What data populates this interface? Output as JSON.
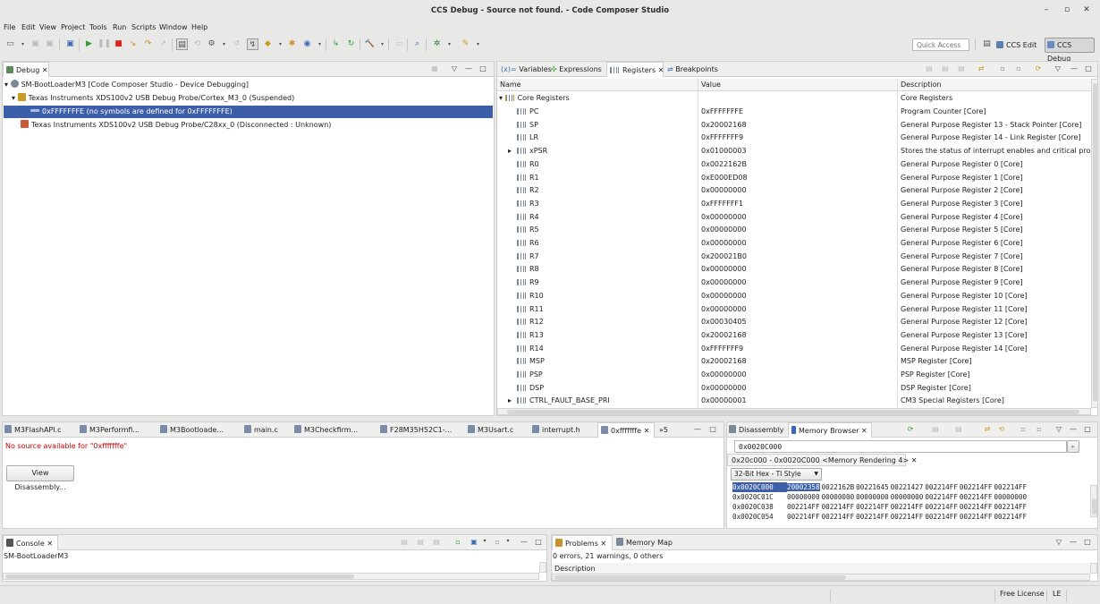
{
  "window": {
    "title": "CCS Debug - Source not found. - Code Composer Studio",
    "minimize": "–",
    "maximize": "▫",
    "close": "✕"
  },
  "menu": [
    "File",
    "Edit",
    "View",
    "Project",
    "Tools",
    "Run",
    "Scripts",
    "Window",
    "Help"
  ],
  "toolbar": {
    "quick_access_placeholder": "Quick Access",
    "perspective_edit": "CCS Edit",
    "perspective_debug": "CCS Debug"
  },
  "debug_view": {
    "tab": "Debug",
    "tree": [
      {
        "label": "SM-BootLoaderM3 [Code Composer Studio - Device Debugging]",
        "icon": "launch-icon"
      },
      {
        "label": "Texas Instruments XDS100v2 USB Debug Probe/Cortex_M3_0 (Suspended)",
        "icon": "cpu-icon"
      },
      {
        "label": "0xFFFFFFFE  (no symbols are defined for 0xFFFFFFFE)",
        "icon": "stack-frame-icon",
        "selected": true
      },
      {
        "label": "Texas Instruments XDS100v2 USB Debug Probe/C28xx_0 (Disconnected : Unknown)",
        "icon": "cpu-disconnected-icon"
      }
    ]
  },
  "registers_view": {
    "tabs": [
      "Variables",
      "Expressions",
      "Registers",
      "Breakpoints"
    ],
    "active_tab": "Registers",
    "columns": [
      "Name",
      "Value",
      "Description"
    ],
    "group": {
      "name": "Core Registers",
      "description": "Core Registers"
    },
    "rows": [
      {
        "name": "PC",
        "value": "0xFFFFFFFE",
        "desc": "Program Counter [Core]"
      },
      {
        "name": "SP",
        "value": "0x20002168",
        "desc": "General Purpose Register 13 - Stack Pointer [Core]"
      },
      {
        "name": "LR",
        "value": "0xFFFFFFF9",
        "desc": "General Purpose Register 14 - Link Register [Core]"
      },
      {
        "name": "xPSR",
        "value": "0x01000003",
        "desc": "Stores the status of interrupt enables and critical processor s",
        "expand": true
      },
      {
        "name": "R0",
        "value": "0x0022162B",
        "desc": "General Purpose Register 0 [Core]"
      },
      {
        "name": "R1",
        "value": "0xE000ED08",
        "desc": "General Purpose Register 1 [Core]"
      },
      {
        "name": "R2",
        "value": "0x00000000",
        "desc": "General Purpose Register 2 [Core]"
      },
      {
        "name": "R3",
        "value": "0xFFFFFFF1",
        "desc": "General Purpose Register 3 [Core]"
      },
      {
        "name": "R4",
        "value": "0x00000000",
        "desc": "General Purpose Register 4 [Core]"
      },
      {
        "name": "R5",
        "value": "0x00000000",
        "desc": "General Purpose Register 5 [Core]"
      },
      {
        "name": "R6",
        "value": "0x00000000",
        "desc": "General Purpose Register 6 [Core]"
      },
      {
        "name": "R7",
        "value": "0x200021B0",
        "desc": "General Purpose Register 7 [Core]"
      },
      {
        "name": "R8",
        "value": "0x00000000",
        "desc": "General Purpose Register 8 [Core]"
      },
      {
        "name": "R9",
        "value": "0x00000000",
        "desc": "General Purpose Register 9 [Core]"
      },
      {
        "name": "R10",
        "value": "0x00000000",
        "desc": "General Purpose Register 10 [Core]"
      },
      {
        "name": "R11",
        "value": "0x00000000",
        "desc": "General Purpose Register 11 [Core]"
      },
      {
        "name": "R12",
        "value": "0x00030405",
        "desc": "General Purpose Register 12 [Core]"
      },
      {
        "name": "R13",
        "value": "0x20002168",
        "desc": "General Purpose Register 13 [Core]"
      },
      {
        "name": "R14",
        "value": "0xFFFFFFF9",
        "desc": "General Purpose Register 14 [Core]"
      },
      {
        "name": "MSP",
        "value": "0x20002168",
        "desc": "MSP Register [Core]"
      },
      {
        "name": "PSP",
        "value": "0x00000000",
        "desc": "PSP Register [Core]"
      },
      {
        "name": "DSP",
        "value": "0x00000000",
        "desc": "DSP Register [Core]"
      },
      {
        "name": "CTRL_FAULT_BASE_PRI",
        "value": "0x00000001",
        "desc": "CM3 Special Registers [Core]",
        "expand": true
      }
    ]
  },
  "editor": {
    "tabs": [
      "M3FlashAPI.c",
      "M3Performfi...",
      "M3Bootloade...",
      "main.c",
      "M3Checkfirm...",
      "F28M35H52C1-...",
      "M3Usart.c",
      "interrupt.h",
      "0xfffffffe"
    ],
    "active_tab": "0xfffffffe",
    "overflow": "»5",
    "message": "No source available for \"0xfffffffe\"",
    "button": "View Disassembly..."
  },
  "memory_view": {
    "tabs": [
      "Disassembly",
      "Memory Browser"
    ],
    "active_tab": "Memory Browser",
    "address_input": "0x0020C000",
    "rendering_tab": "0x20c000 - 0x0020C000 <Memory Rendering 4>",
    "format": "32-Bit Hex - TI Style",
    "rows": [
      {
        "addr": "0x0020C000",
        "cells": [
          "20002358",
          "0022162B",
          "00221645",
          "00221427",
          "002214FF",
          "002214FF",
          "002214FF"
        ]
      },
      {
        "addr": "0x0020C01C",
        "cells": [
          "00000000",
          "00000000",
          "00000000",
          "00000000",
          "002214FF",
          "002214FF",
          "00000000"
        ]
      },
      {
        "addr": "0x0020C038",
        "cells": [
          "002214FF",
          "002214FF",
          "002214FF",
          "002214FF",
          "002214FF",
          "002214FF",
          "002214FF"
        ]
      },
      {
        "addr": "0x0020C054",
        "cells": [
          "002214FF",
          "002214FF",
          "002214FF",
          "002214FF",
          "002214FF",
          "002214FF",
          "002214FF"
        ]
      }
    ]
  },
  "console": {
    "tab": "Console",
    "line": "SM-BootLoaderM3"
  },
  "problems": {
    "tabs": [
      "Problems",
      "Memory Map"
    ],
    "summary": "0 errors, 21 warnings, 0 others",
    "column": "Description"
  },
  "statusbar": {
    "license": "Free License",
    "mode": "LE"
  },
  "colors": {
    "selection": "#3d5ea8",
    "accent": "#3a67b7",
    "error_text": "#cc0000"
  }
}
